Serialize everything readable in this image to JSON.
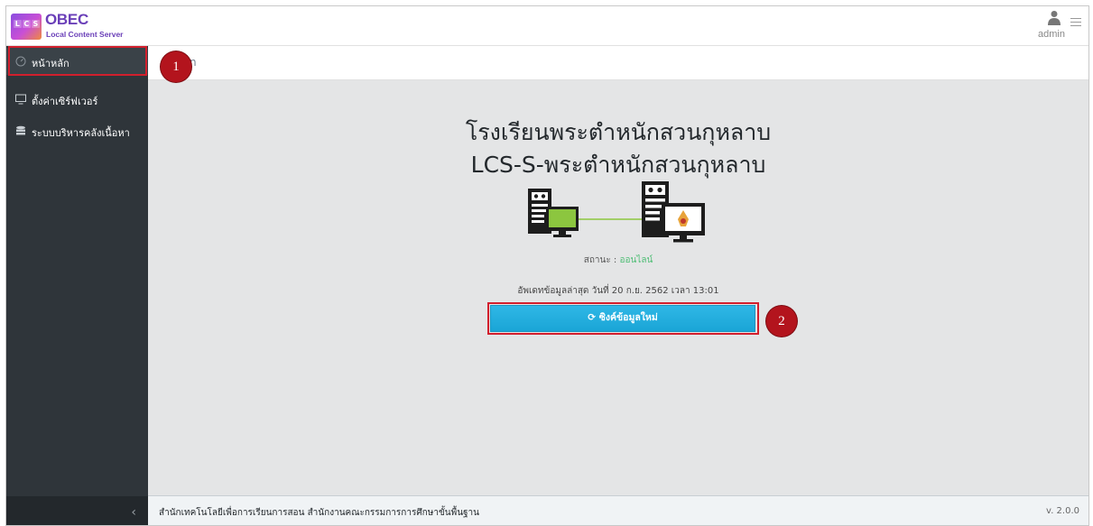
{
  "header": {
    "logo_title": "OBEC",
    "logo_subtitle": "Local Content Server",
    "logo_badge": [
      "L",
      "C",
      "S"
    ],
    "user_name": "admin"
  },
  "sidebar": {
    "items": [
      {
        "label": "หน้าหลัก",
        "icon": "speedometer-icon",
        "active": true
      },
      {
        "label": "ตั้งค่าเซิร์ฟเวอร์",
        "icon": "monitor-icon",
        "active": false
      },
      {
        "label": "ระบบบริหารคลังเนื้อหา",
        "icon": "database-icon",
        "active": false
      }
    ],
    "collapse_glyph": "‹"
  },
  "breadcrumb": {
    "text": "n"
  },
  "main": {
    "school_name": "โรงเรียนพระตำหนักสวนกุหลาบ",
    "server_name": "LCS-S-พระตำหนักสวนกุหลาบ",
    "status_label": "สถานะ :",
    "status_value": "ออนไลน์",
    "last_update": "อัพเดทข้อมูลล่าสุด วันที่ 20 ก.ย. 2562 เวลา 13:01",
    "sync_button": "ซิงค์ข้อมูลใหม่"
  },
  "markers": {
    "first": "1",
    "second": "2"
  },
  "footer": {
    "left": "สำนักเทคโนโลยีเพื่อการเรียนการสอน สำนักงานคณะกรรมการการศึกษาขั้นพื้นฐาน",
    "version": "v. 2.0.0"
  },
  "colors": {
    "sidebar_bg": "#2f353a",
    "accent_button": "#20a8d8",
    "status_online": "#4dbd74",
    "highlight_border": "#d21f2d",
    "marker_fill": "#b3141d"
  }
}
